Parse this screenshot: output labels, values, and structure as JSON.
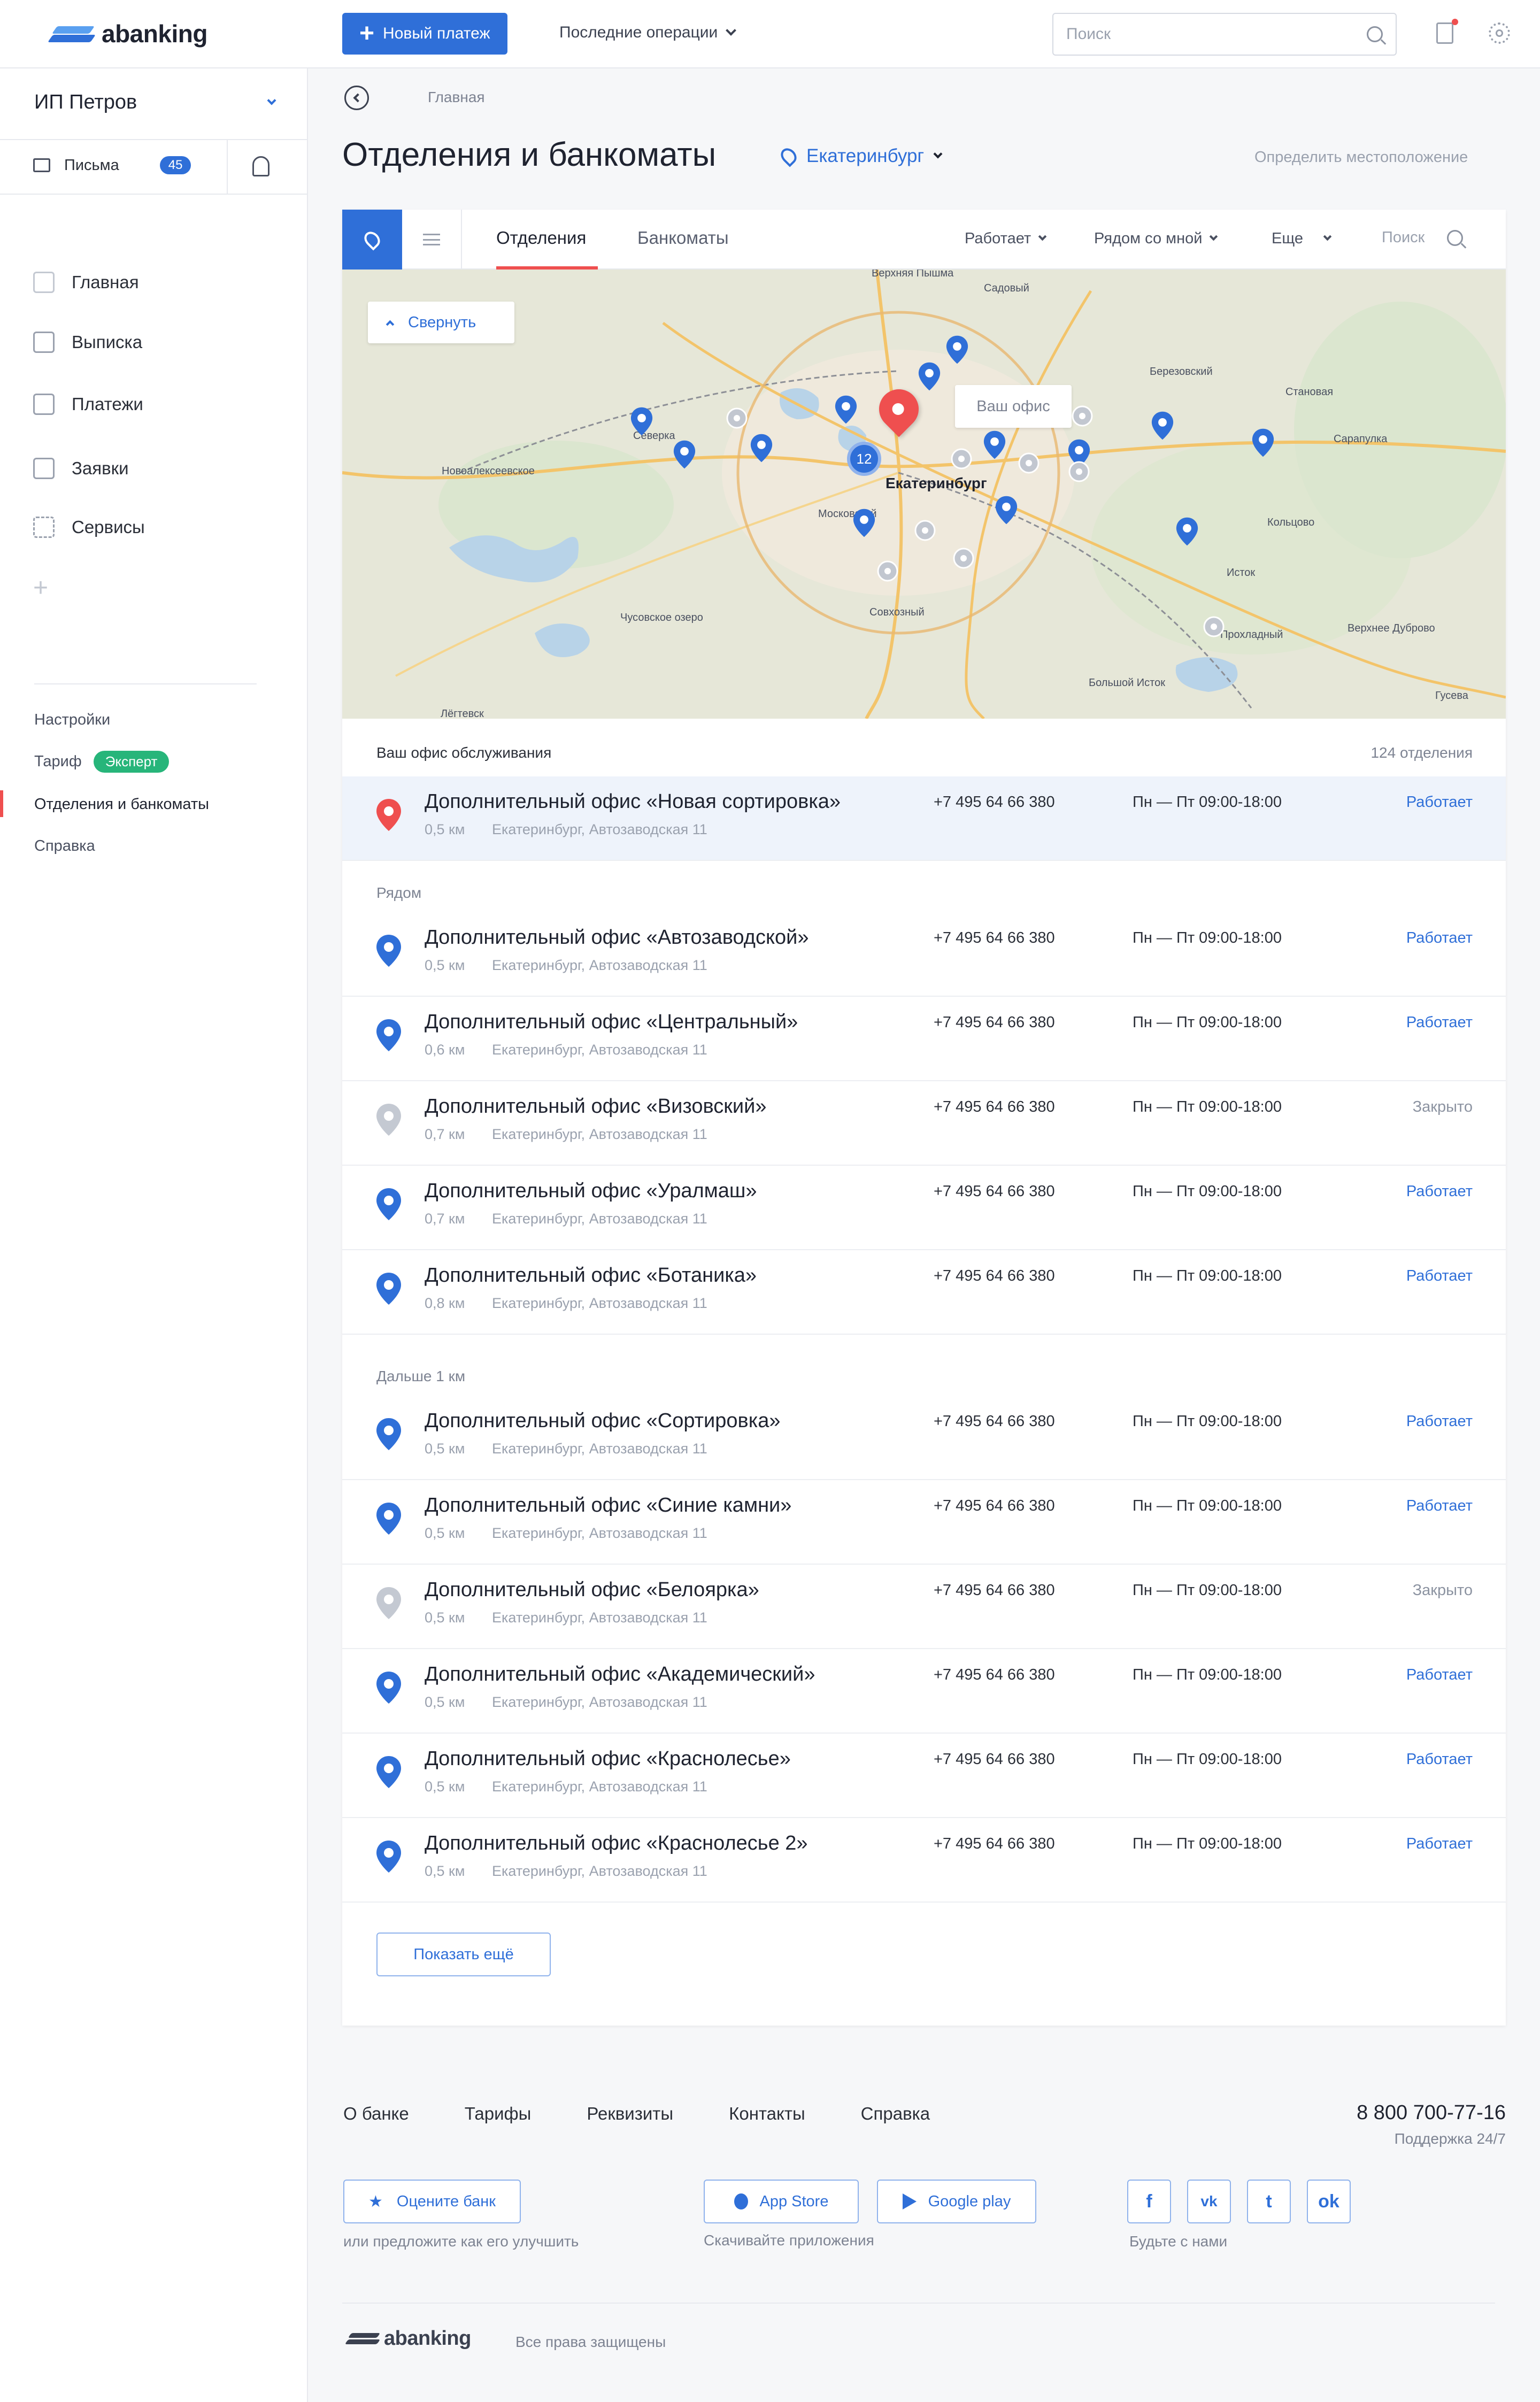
{
  "header": {
    "logo_text": "abanking",
    "new_payment": "Новый платеж",
    "recent_ops": "Последние операции",
    "search_placeholder": "Поиск"
  },
  "sidebar": {
    "company": "ИП Петров",
    "letters_label": "Письма",
    "letters_count": "45",
    "nav": [
      {
        "label": "Главная",
        "icon": "home-icon"
      },
      {
        "label": "Выписка",
        "icon": "statement-icon"
      },
      {
        "label": "Платежи",
        "icon": "wallet-icon"
      },
      {
        "label": "Заявки",
        "icon": "document-icon"
      },
      {
        "label": "Сервисы",
        "icon": "grid-icon"
      }
    ],
    "links": {
      "settings": "Настройки",
      "tariff": "Тариф",
      "tariff_badge": "Эксперт",
      "offices": "Отделения и банкоматы",
      "help": "Справка"
    }
  },
  "page": {
    "breadcrumb": "Главная",
    "title": "Отделения и банкоматы",
    "city": "Екатеринбург",
    "locate": "Определить местоположение"
  },
  "tabs": {
    "offices": "Отделения",
    "atms": "Банкоматы",
    "filter_working": "Работает",
    "filter_near": "Рядом со мной",
    "filter_more": "Еще",
    "search": "Поиск"
  },
  "map": {
    "collapse": "Свернуть",
    "your_office": "Ваш офис",
    "city_label": "Екатеринбург",
    "cluster_count": "12",
    "places": [
      "Березовский",
      "Исток",
      "Верхнее Дуброво",
      "Большой Исток",
      "Совхозный",
      "Северка",
      "Садовый",
      "Кольцово",
      "Гусева",
      "Сарапулка",
      "Становая",
      "Прохладный",
      "Лёгтевск",
      "Верхняя Пышма",
      "Новоалексеевское",
      "Чусовское озеро",
      "Московский"
    ]
  },
  "list": {
    "service_office_label": "Ваш офис обслуживания",
    "total": "124 отделения",
    "near_label": "Рядом",
    "far_label": "Дальше 1 км",
    "show_more": "Показать ещё",
    "status_colors": {
      "open": "#2f6fd8",
      "closed": "#8c93a1"
    },
    "service_office": {
      "name": "Дополнительный офис «Новая сортировка»",
      "dist": "0,5 км",
      "addr": "Екатеринбург, Автозаводская 11",
      "phone": "+7 495 64 66 380",
      "hours": "Пн — Пт  09:00-18:00",
      "status": "Работает",
      "open": true
    },
    "near": [
      {
        "name": "Дополнительный офис «Автозаводской»",
        "dist": "0,5 км",
        "addr": "Екатеринбург, Автозаводская 11",
        "phone": "+7 495 64 66 380",
        "hours": "Пн — Пт  09:00-18:00",
        "status": "Работает",
        "open": true
      },
      {
        "name": "Дополнительный офис «Центральный»",
        "dist": "0,6 км",
        "addr": "Екатеринбург, Автозаводская 11",
        "phone": "+7 495 64 66 380",
        "hours": "Пн — Пт  09:00-18:00",
        "status": "Работает",
        "open": true
      },
      {
        "name": "Дополнительный офис «Визовский»",
        "dist": "0,7 км",
        "addr": "Екатеринбург, Автозаводская 11",
        "phone": "+7 495 64 66 380",
        "hours": "Пн — Пт  09:00-18:00",
        "status": "Закрыто",
        "open": false
      },
      {
        "name": "Дополнительный офис «Уралмаш»",
        "dist": "0,7 км",
        "addr": "Екатеринбург, Автозаводская 11",
        "phone": "+7 495 64 66 380",
        "hours": "Пн — Пт  09:00-18:00",
        "status": "Работает",
        "open": true
      },
      {
        "name": "Дополнительный офис «Ботаника»",
        "dist": "0,8 км",
        "addr": "Екатеринбург, Автозаводская 11",
        "phone": "+7 495 64 66 380",
        "hours": "Пн — Пт  09:00-18:00",
        "status": "Работает",
        "open": true
      }
    ],
    "far": [
      {
        "name": "Дополнительный офис «Сортировка»",
        "dist": "0,5 км",
        "addr": "Екатеринбург, Автозаводская 11",
        "phone": "+7 495 64 66 380",
        "hours": "Пн — Пт  09:00-18:00",
        "status": "Работает",
        "open": true
      },
      {
        "name": "Дополнительный офис «Синие камни»",
        "dist": "0,5 км",
        "addr": "Екатеринбург, Автозаводская 11",
        "phone": "+7 495 64 66 380",
        "hours": "Пн — Пт  09:00-18:00",
        "status": "Работает",
        "open": true
      },
      {
        "name": "Дополнительный офис «Белоярка»",
        "dist": "0,5 км",
        "addr": "Екатеринбург, Автозаводская 11",
        "phone": "+7 495 64 66 380",
        "hours": "Пн — Пт  09:00-18:00",
        "status": "Закрыто",
        "open": false
      },
      {
        "name": "Дополнительный офис «Академический»",
        "dist": "0,5 км",
        "addr": "Екатеринбург, Автозаводская 11",
        "phone": "+7 495 64 66 380",
        "hours": "Пн — Пт  09:00-18:00",
        "status": "Работает",
        "open": true
      },
      {
        "name": "Дополнительный офис «Краснолесье»",
        "dist": "0,5 км",
        "addr": "Екатеринбург, Автозаводская 11",
        "phone": "+7 495 64 66 380",
        "hours": "Пн — Пт  09:00-18:00",
        "status": "Работает",
        "open": true
      },
      {
        "name": "Дополнительный офис «Краснолесье 2»",
        "dist": "0,5 км",
        "addr": "Екатеринбург, Автозаводская 11",
        "phone": "+7 495 64 66 380",
        "hours": "Пн — Пт  09:00-18:00",
        "status": "Работает",
        "open": true
      }
    ]
  },
  "footer": {
    "links": [
      "О банке",
      "Тарифы",
      "Реквизиты",
      "Контакты",
      "Справка"
    ],
    "phone": "8 800 700-77-16",
    "support": "Поддержка  24/7",
    "rate_bank": "Оцените банк",
    "rate_caption": "или предложите как его улучшить",
    "app_store": "App Store",
    "google_play": "Google play",
    "apps_caption": "Скачивайте приложения",
    "social_caption": "Будьте с нами",
    "logo_text": "abanking",
    "rights": "Все права защищены"
  },
  "colors": {
    "accent": "#2f6fd8",
    "green": "#27b57a",
    "red_pin": "#ef4f4f"
  }
}
